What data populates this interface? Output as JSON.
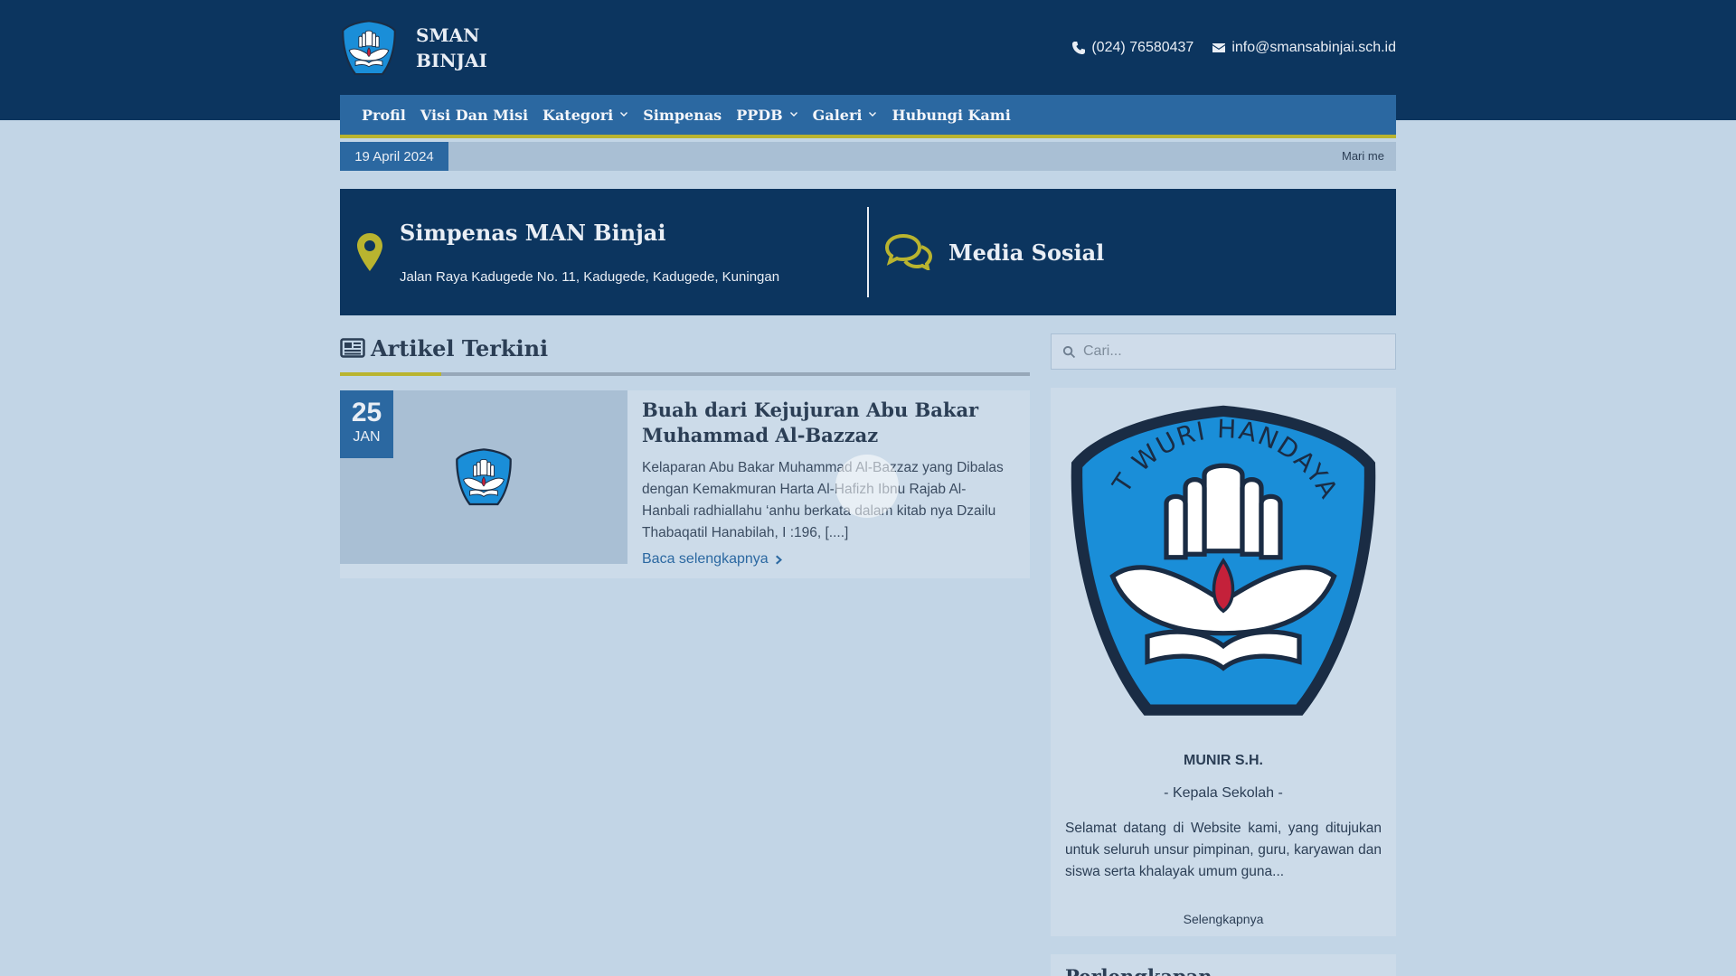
{
  "site": {
    "name": "SMAN BINJAI",
    "phone": "(024) 76580437",
    "email": "info@smansabinjai.sch.id"
  },
  "nav": {
    "items": [
      {
        "label": "Profil",
        "dropdown": false
      },
      {
        "label": "Visi Dan Misi",
        "dropdown": false
      },
      {
        "label": "Kategori",
        "dropdown": true
      },
      {
        "label": "Simpenas",
        "dropdown": false
      },
      {
        "label": "PPDB",
        "dropdown": true
      },
      {
        "label": "Galeri",
        "dropdown": true
      },
      {
        "label": "Hubungi Kami",
        "dropdown": false
      }
    ]
  },
  "ticker": {
    "date": "19 April 2024",
    "text": "Mari me"
  },
  "info": {
    "location_title": "Simpenas MAN Binjai",
    "address": "Jalan Raya Kadugede No. 11, Kadugede, Kadugede, Kuningan",
    "social_title": "Media Sosial"
  },
  "articles": {
    "section_title": "Artikel Terkini",
    "items": [
      {
        "day": "25",
        "month": "JAN",
        "title": "Buah dari Kejujuran Abu Bakar Muhammad Al-Bazzaz",
        "excerpt": "Kelaparan Abu Bakar Muhammad Al-Bazzaz yang Dibalas dengan Kemakmuran Harta Al-Hafizh Ibnu Rajab Al-Hanbali radhiallahu ‘anhu berkata dalam kitab nya Dzailu Thabaqatil Hanabilah, I :196, [....]",
        "read_more": "Baca selengkapnya"
      }
    ]
  },
  "sidebar": {
    "search_placeholder": "Cari...",
    "logo_motto": "TUT WURI HANDAYANI",
    "head_name": "MUNIR S.H.",
    "head_role": "- Kepala Sekolah -",
    "greeting": "Selamat datang di Website kami, yang ditujukan untuk seluruh unsur pimpinan, guru, karyawan dan siswa serta khalayak umum guna...",
    "more_label": "Selengkapnya",
    "next_heading": "Perlengkapan"
  },
  "colors": {
    "header_bg": "#0c355f",
    "nav_bg": "#2b68a1",
    "accent": "#b9b42f",
    "page_bg": "#c2d5e6"
  }
}
